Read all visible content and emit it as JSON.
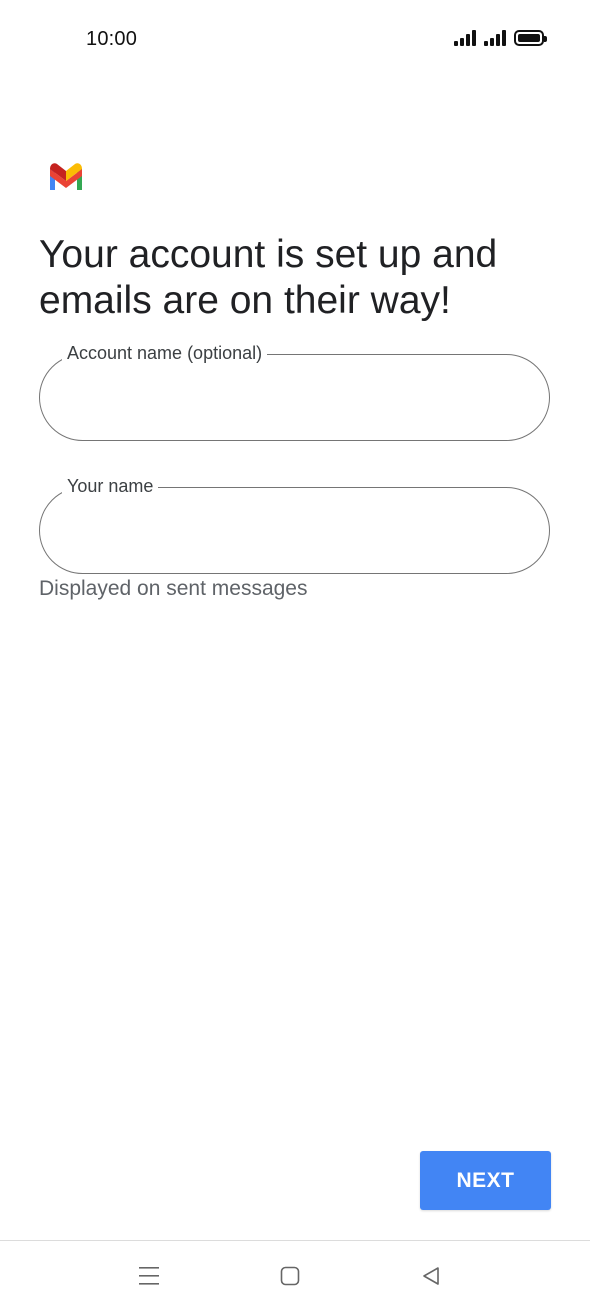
{
  "status_bar": {
    "time": "10:00",
    "icons": [
      "signal-icon",
      "signal-icon",
      "battery-icon"
    ]
  },
  "app": {
    "logo": "gmail-logo-icon"
  },
  "headline": "Your account is set up and emails are on their way!",
  "form": {
    "account_name": {
      "label": "Account name (optional)",
      "value": ""
    },
    "your_name": {
      "label": "Your name",
      "value": ""
    },
    "helper_text": "Displayed on sent messages"
  },
  "actions": {
    "next_label": "NEXT"
  },
  "colors": {
    "accent": "#4285f4",
    "outline": "#757575",
    "text_primary": "#202124",
    "text_secondary": "#5f6368"
  },
  "nav_bar": {
    "buttons": [
      "menu-icon",
      "home-icon",
      "back-icon"
    ]
  }
}
